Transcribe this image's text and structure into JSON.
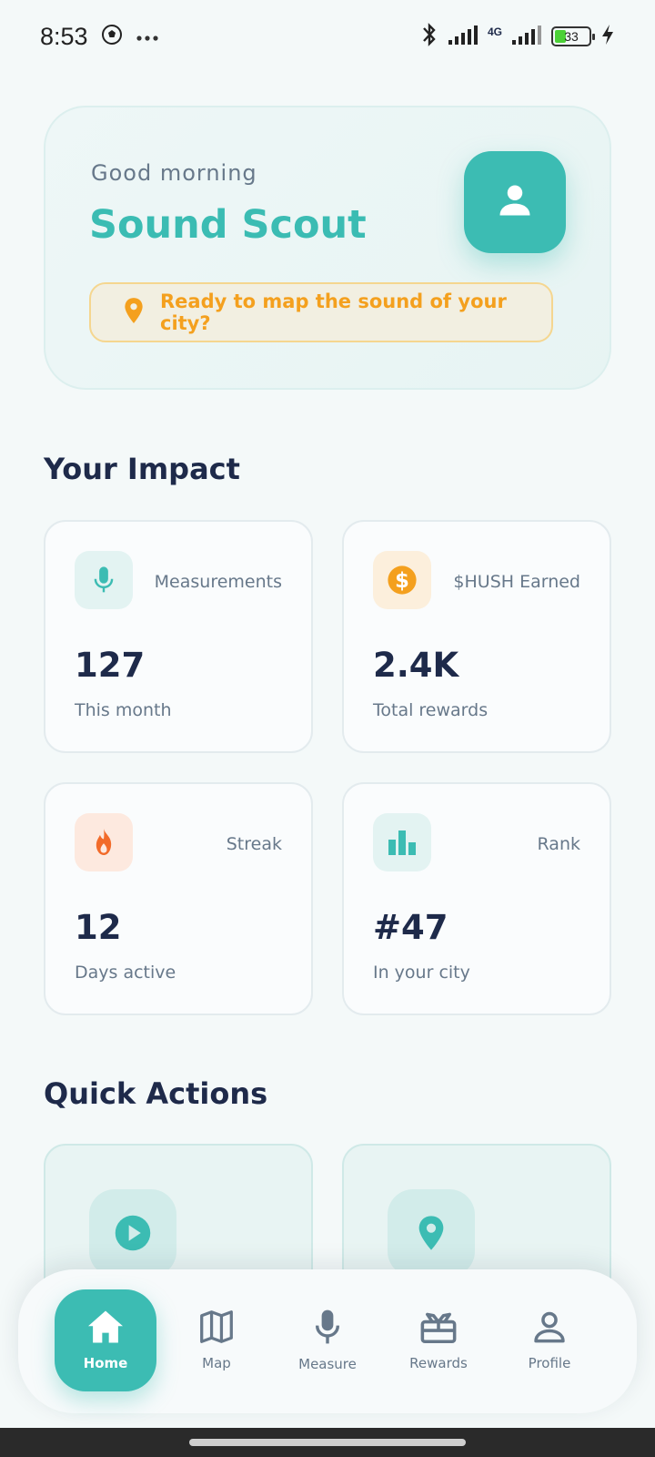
{
  "status_bar": {
    "time": "8:53",
    "network": "4G",
    "battery": "33"
  },
  "greeting": {
    "label": "Good morning",
    "name": "Sound Scout",
    "banner_text": "Ready to map the sound of your city?"
  },
  "impact": {
    "title": "Your Impact",
    "cards": [
      {
        "label": "Measurements",
        "value": "127",
        "sub": "This month",
        "icon": "microphone-icon",
        "color": "#3cbcb3"
      },
      {
        "label": "$HUSH Earned",
        "value": "2.4K",
        "sub": "Total rewards",
        "icon": "dollar-coin-icon",
        "color": "#f4a01e"
      },
      {
        "label": "Streak",
        "value": "12",
        "sub": "Days active",
        "icon": "fire-icon",
        "color": "#f26b2a"
      },
      {
        "label": "Rank",
        "value": "#47",
        "sub": "In your city",
        "icon": "bar-chart-icon",
        "color": "#3cbcb3"
      }
    ]
  },
  "quick_actions": {
    "title": "Quick Actions",
    "items": [
      {
        "icon": "play-icon"
      },
      {
        "icon": "location-pin-icon"
      }
    ]
  },
  "nav": {
    "items": [
      {
        "label": "Home",
        "icon": "home-icon",
        "active": true
      },
      {
        "label": "Map",
        "icon": "map-icon",
        "active": false
      },
      {
        "label": "Measure",
        "icon": "microphone-icon",
        "active": false
      },
      {
        "label": "Rewards",
        "icon": "gift-icon",
        "active": false
      },
      {
        "label": "Profile",
        "icon": "user-icon",
        "active": false
      }
    ]
  },
  "colors": {
    "accent": "#3cbcb3",
    "warning": "#f4a01e",
    "text_dark": "#1e2a4a",
    "text_muted": "#67788a"
  }
}
